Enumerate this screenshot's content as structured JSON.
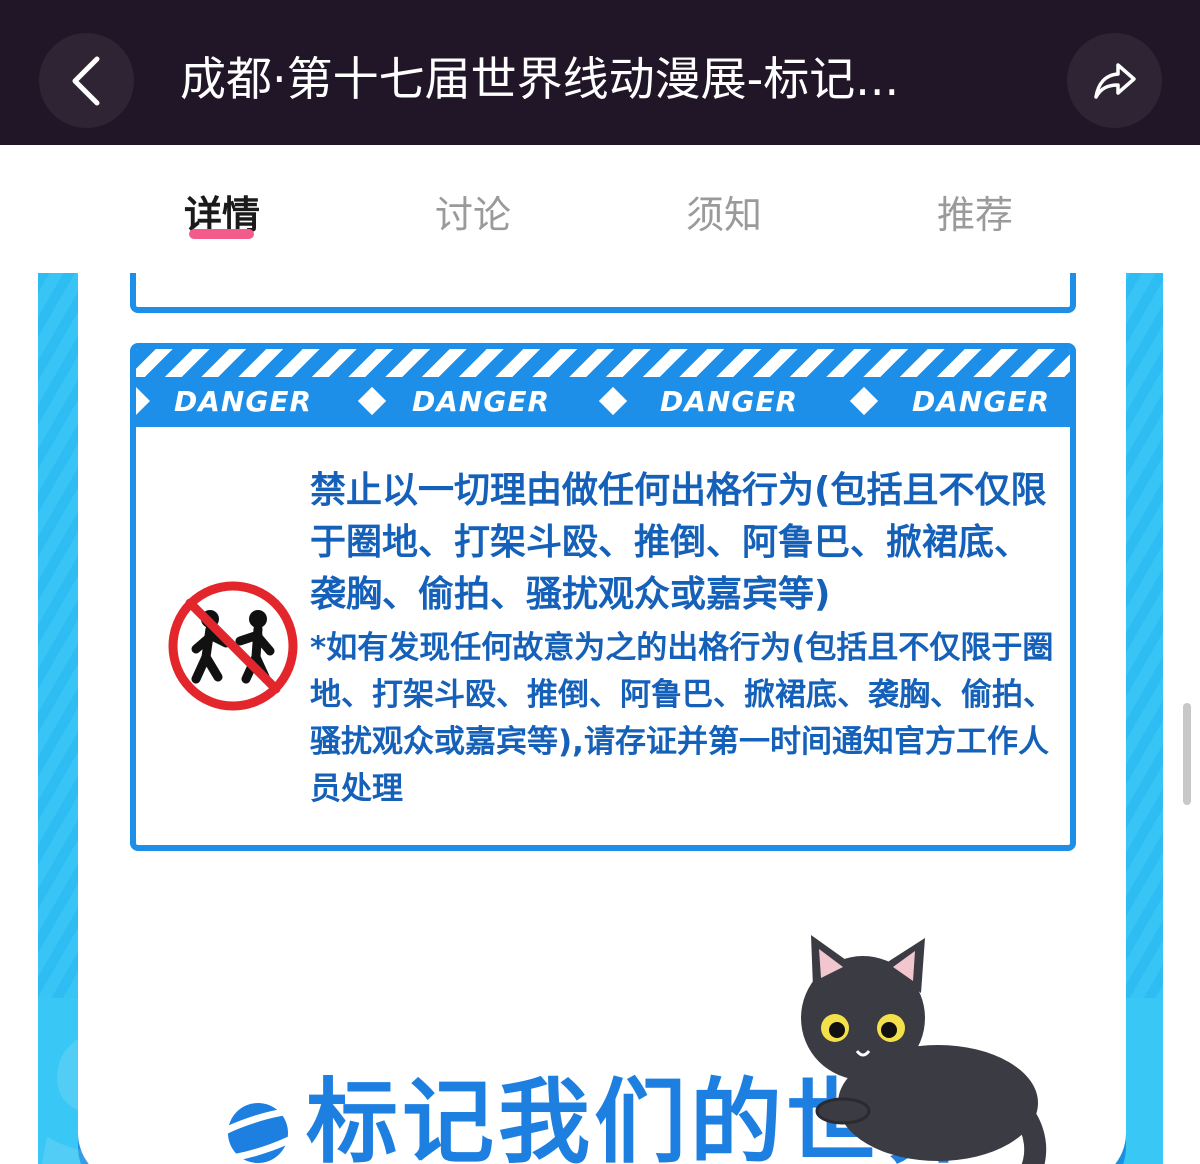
{
  "header": {
    "title": "成都·第十七届世界线动漫展-标记...",
    "back_icon": "chevron-left-icon",
    "share_icon": "share-icon",
    "background": "#211627"
  },
  "tabs": [
    {
      "label": "详情",
      "active": true
    },
    {
      "label": "讨论",
      "active": false
    },
    {
      "label": "须知",
      "active": false
    },
    {
      "label": "推荐",
      "active": false
    }
  ],
  "accent_color": "#f25b8a",
  "poster": {
    "danger_band": [
      "DANGER",
      "DANGER",
      "DANGER",
      "DANGER"
    ],
    "rule_main": "禁止以一切理由做任何出格行为(包括且不仅限于圈地、打架斗殴、推倒、阿鲁巴、掀裙底、袭胸、偷拍、骚扰观众或嘉宾等)",
    "rule_note": "*如有发现任何故意为之的出格行为(包括且不仅限于圈地、打架斗殴、推倒、阿鲁巴、掀裙底、袭胸、偷拍、骚扰观众或嘉宾等),请存证并第一时间通知官方工作人员处理",
    "banner_title": "标记我们的世界",
    "text_color": "#1560b8",
    "band_color": "#1d8fe8"
  }
}
